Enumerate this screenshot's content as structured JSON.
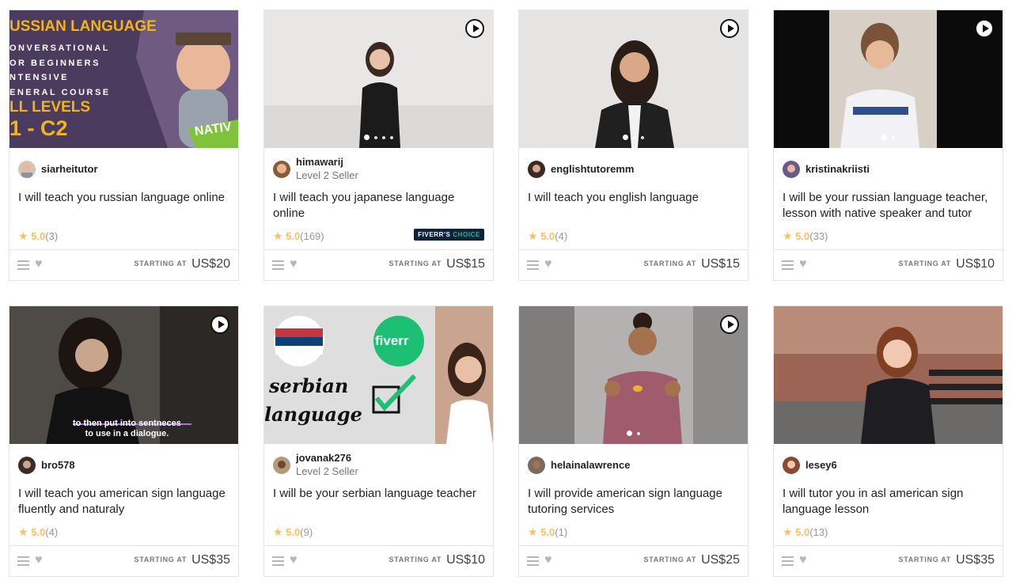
{
  "play_icon": "play-icon",
  "cards": [
    {
      "seller": "siarheitutor",
      "level": "",
      "title": "I will teach you russian language online",
      "rating": "5.0",
      "count": "(3)",
      "starting_label": "STARTING AT",
      "price": "US$20",
      "choice": "",
      "thumb_text": {
        "line1": "USSIAN LANGUAGE",
        "line2": "ONVERSATIONAL",
        "line3": "OR BEGINNERS",
        "line4": "NTENSIVE",
        "line5": "ENERAL COURSE",
        "line6": "LL LEVELS",
        "line7": "1 - C2",
        "badge": "NATIV"
      }
    },
    {
      "seller": "himawarij",
      "level": "Level 2 Seller",
      "title": "I will teach you japanese language online",
      "rating": "5.0",
      "count": "(169)",
      "starting_label": "STARTING AT",
      "price": "US$15",
      "choice": "FIVERR'S CHOICE"
    },
    {
      "seller": "englishtutoremm",
      "level": "",
      "title": "I will teach you english language",
      "rating": "5.0",
      "count": "(4)",
      "starting_label": "STARTING AT",
      "price": "US$15",
      "choice": ""
    },
    {
      "seller": "kristinakriisti",
      "level": "",
      "title": "I will be your russian language teacher, lesson with native speaker and tutor",
      "rating": "5.0",
      "count": "(33)",
      "starting_label": "STARTING AT",
      "price": "US$10",
      "choice": ""
    },
    {
      "seller": "bro578",
      "level": "",
      "title": "I will teach you american sign language fluently and naturaly",
      "rating": "5.0",
      "count": "(4)",
      "starting_label": "STARTING AT",
      "price": "US$35",
      "choice": "",
      "caption": "to then put into sentneces\nto use in a dialogue."
    },
    {
      "seller": "jovanak276",
      "level": "Level 2 Seller",
      "title": "I will be your serbian language teacher",
      "rating": "5.0",
      "count": "(9)",
      "starting_label": "STARTING AT",
      "price": "US$10",
      "choice": "",
      "thumb_text": {
        "word1": "serbian",
        "word2": "language",
        "logo": "fiverr"
      }
    },
    {
      "seller": "helainalawrence",
      "level": "",
      "title": "I will provide american sign language tutoring services",
      "rating": "5.0",
      "count": "(1)",
      "starting_label": "STARTING AT",
      "price": "US$25",
      "choice": ""
    },
    {
      "seller": "lesey6",
      "level": "",
      "title": "I will tutor you in asl american sign language lesson",
      "rating": "5.0",
      "count": "(13)",
      "starting_label": "STARTING AT",
      "price": "US$35",
      "choice": ""
    }
  ]
}
